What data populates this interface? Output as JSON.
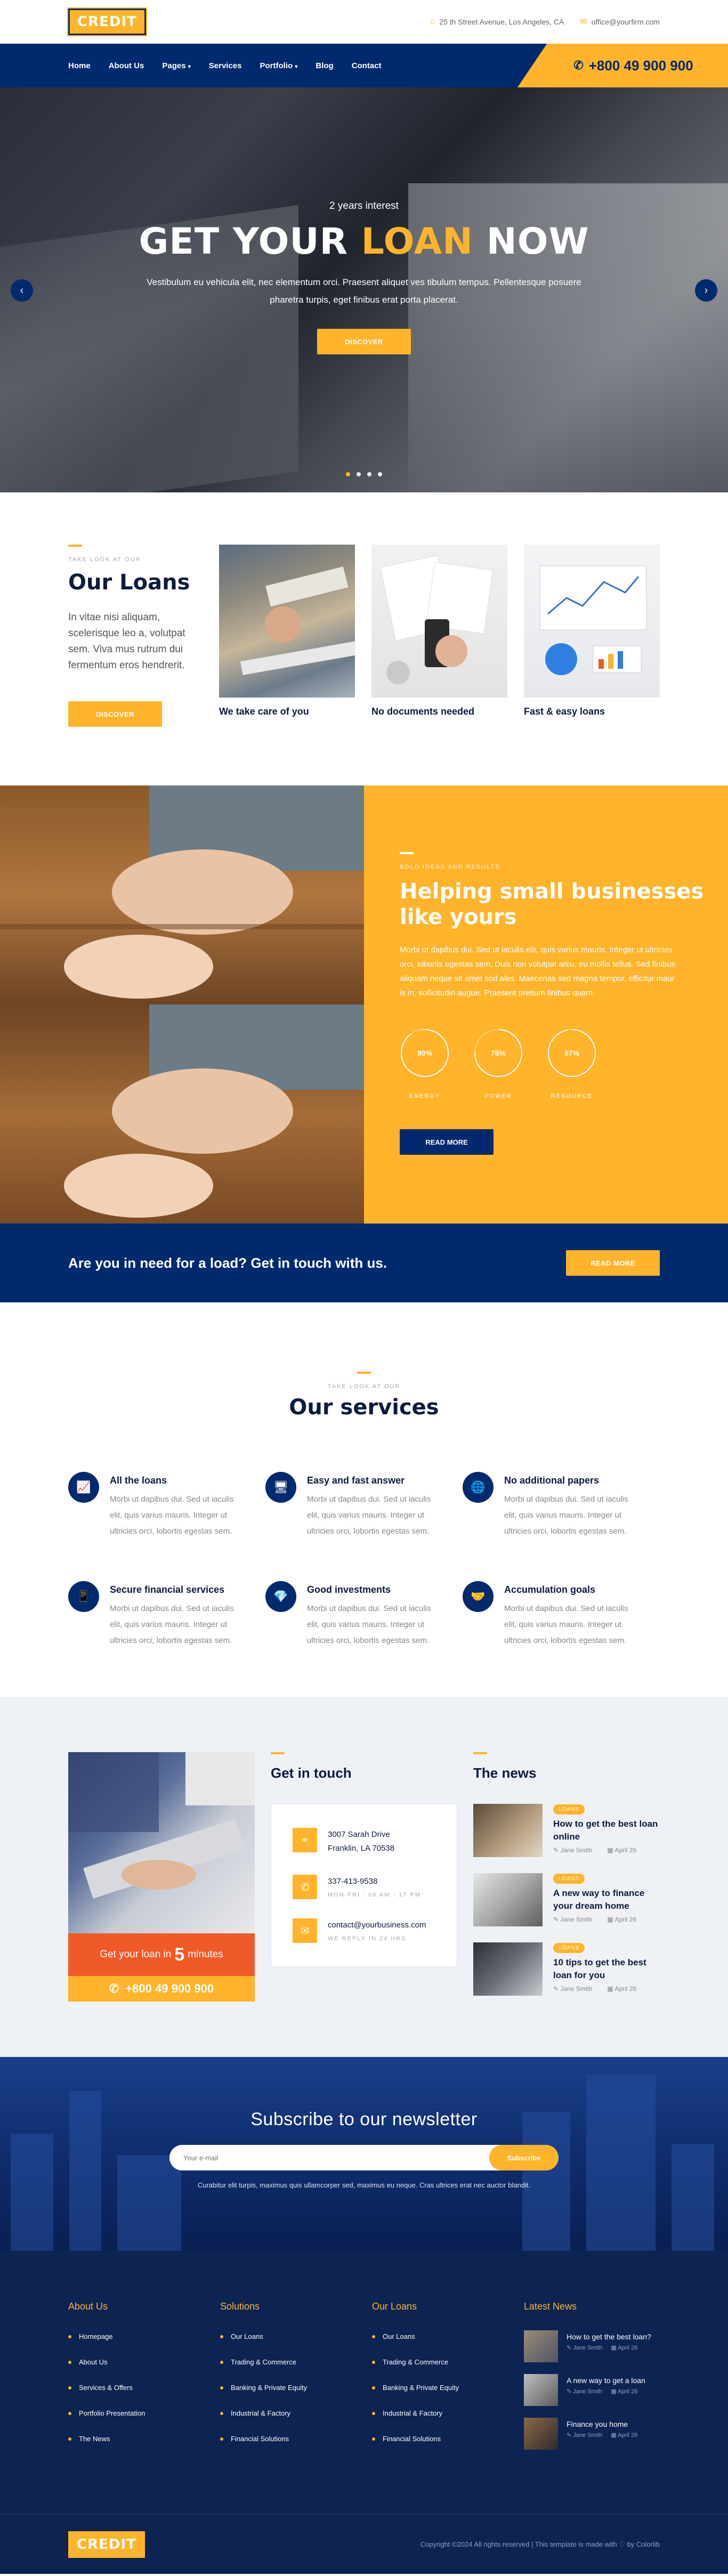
{
  "brand": {
    "logo": "CREDIT"
  },
  "topbar": {
    "address": "25 th Street Avenue, Los Angeles, CA",
    "email": "office@yourfirm.com"
  },
  "nav": {
    "items": [
      {
        "label": "Home"
      },
      {
        "label": "About Us"
      },
      {
        "label": "Pages",
        "dropdown": true
      },
      {
        "label": "Services"
      },
      {
        "label": "Portfolio",
        "dropdown": true
      },
      {
        "label": "Blog"
      },
      {
        "label": "Contact"
      }
    ],
    "phone": "+800 49 900 900"
  },
  "hero": {
    "subtitle": "2 years interest",
    "title_1": "GET YOUR ",
    "title_hl": "LOAN",
    "title_2": " NOW",
    "text": "Vestibulum eu vehicula elit, nec elementum orci. Praesent aliquet ves tibulum tempus. Pellentesque posuere pharetra turpis, eget finibus erat porta placerat.",
    "button": "DISCOVER"
  },
  "loans": {
    "eyebrow": "TAKE LOOK AT OUR",
    "title": "Our Loans",
    "text": "In vitae nisi aliquam, scelerisque leo a, volutpat sem. Viva mus rutrum dui fermentum eros hendrerit.",
    "button": "DISCOVER",
    "cards": [
      {
        "title": "We take care of you"
      },
      {
        "title": "No documents needed"
      },
      {
        "title": "Fast & easy loans"
      }
    ]
  },
  "helping": {
    "eyebrow": "BOLD IDEAS AND RESULTS",
    "title": "Helping small businesses like yours",
    "text": "Morbi ut dapibus dui. Sed ut iaculis elit, quis varius mauris. Integer ut ultricies orci, lobortis egestas sem. Duis non volutpat arcu, eu mollis tellus. Sed finibus aliquam neque sit amet sod ales. Maecenas sed magna tempor, efficitur maur is in, sollicitudin augue. Praesent pretium finibus quam.",
    "stats": [
      {
        "value": "90%",
        "percent": 90,
        "label": "ENERGY"
      },
      {
        "value": "75%",
        "percent": 75,
        "label": "POWER"
      },
      {
        "value": "97%",
        "percent": 97,
        "label": "RESOURCE"
      }
    ],
    "button": "READ MORE"
  },
  "cta": {
    "text": "Are you in need for a load? Get in touch with us.",
    "button": "READ MORE"
  },
  "services": {
    "eyebrow": "TAKE LOOK AT OUR",
    "title": "Our services",
    "items": [
      {
        "title": "All the loans",
        "text": "Morbi ut dapibus dui. Sed ut iaculis elit, quis varius mauris. Integer ut ultricies orci, lobortis egestas sem.",
        "icon": "chart-icon"
      },
      {
        "title": "Easy and fast answer",
        "text": "Morbi ut dapibus dui. Sed ut iaculis elit, quis varius mauris. Integer ut ultricies orci, lobortis egestas sem.",
        "icon": "browser-icon"
      },
      {
        "title": "No additional papers",
        "text": "Morbi ut dapibus dui. Sed ut iaculis elit, quis varius mauris. Integer ut ultricies orci, lobortis egestas sem.",
        "icon": "globe-icon"
      },
      {
        "title": "Secure financial services",
        "text": "Morbi ut dapibus dui. Sed ut iaculis elit, quis varius mauris. Integer ut ultricies orci, lobortis egestas sem.",
        "icon": "phone-icon"
      },
      {
        "title": "Good investments",
        "text": "Morbi ut dapibus dui. Sed ut iaculis elit, quis varius mauris. Integer ut ultricies orci, lobortis egestas sem.",
        "icon": "diamond-icon"
      },
      {
        "title": "Accumulation goals",
        "text": "Morbi ut dapibus dui. Sed ut iaculis elit, quis varius mauris. Integer ut ultricies orci, lobortis egestas sem.",
        "icon": "handshake-icon"
      }
    ]
  },
  "loan_box": {
    "text_1": "Get your loan in",
    "number": "5",
    "text_2": "minutes",
    "phone": "+800 49 900 900"
  },
  "touch": {
    "title": "Get in touch",
    "address": "3007 Sarah Drive",
    "city": "Franklin, LA 70538",
    "phone": "337-413-9538",
    "hours": "MON-FRI : 08 AM - 17 PM",
    "email": "contact@yourbusiness.com",
    "reply": "WE REPLY IN 24 HRS"
  },
  "news": {
    "title": "The news",
    "items": [
      {
        "badge": "LOANS",
        "title": "How to get the best loan online",
        "author": "Jane Smith",
        "date": "April 26"
      },
      {
        "badge": "LOANS",
        "title": "A new way to finance your dream home",
        "author": "Jane Smith",
        "date": "April 26"
      },
      {
        "badge": "LOANS",
        "title": "10 tips to get the best loan for you",
        "author": "Jane Smith",
        "date": "April 26"
      }
    ]
  },
  "newsletter": {
    "title": "Subscribe to our newsletter",
    "placeholder": "Your e-mail",
    "button": "Subscribe",
    "text": "Curabitur elit turpis, maximus quis ullamcorper sed, maximus eu neque. Cras ultrices erat nec auctor blandit."
  },
  "footer": {
    "about": {
      "title": "About Us",
      "items": [
        "Homepage",
        "About Us",
        "Services & Offers",
        "Portfolio Presentation",
        "The News"
      ]
    },
    "solutions": {
      "title": "Solutions",
      "items": [
        "Our Loans",
        "Trading & Commerce",
        "Banking & Private Equity",
        "Industrial & Factory",
        "Financial Solutions"
      ]
    },
    "loans": {
      "title": "Our Loans",
      "items": [
        "Our Loans",
        "Trading & Commerce",
        "Banking & Private Equity",
        "Industrial & Factory",
        "Financial Solutions"
      ]
    },
    "news": {
      "title": "Latest News",
      "items": [
        {
          "title": "How to get the best loan?",
          "author": "Jane Smith",
          "date": "April 26"
        },
        {
          "title": "A new way to get a loan",
          "author": "Jane Smith",
          "date": "April 26"
        },
        {
          "title": "Finance you home",
          "author": "Jane Smith",
          "date": "April 26"
        }
      ]
    },
    "copyright": "Copyright ©2024 All rights reserved | This template is made with ♡ by Colorlib"
  },
  "colors": {
    "accent": "#ffb42b",
    "primary": "#002a6e",
    "red": "#f05a28",
    "dark": "#0d2351"
  }
}
